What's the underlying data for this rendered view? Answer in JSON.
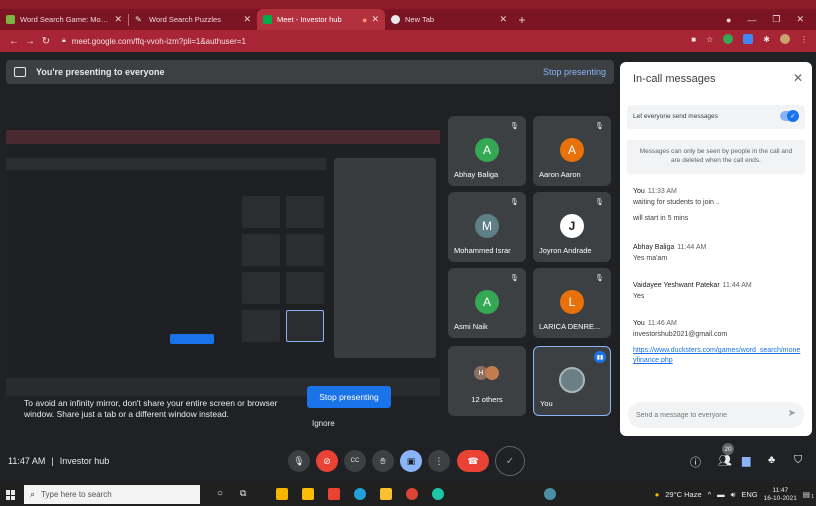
{
  "browser": {
    "tabs": [
      {
        "title": "Word Search Game: Money and",
        "favicon_color": "#7cb342"
      },
      {
        "title": "Word Search Puzzles",
        "favicon_color": "#e8eaed"
      },
      {
        "title": "Meet - Investor hub",
        "favicon_color": "#00ac47"
      },
      {
        "title": "New Tab",
        "favicon_color": "#e8eaed"
      }
    ],
    "url": "meet.google.com/ffq-vvoh-izm?pli=1&authuser=1"
  },
  "banner": {
    "text": "You're presenting to everyone",
    "stop_label": "Stop presenting"
  },
  "presenting": {
    "warning": "To avoid an infinity mirror, don't share your entire screen or browser window. Share just a tab or a different window instead.",
    "stop_button": "Stop presenting",
    "ignore_button": "Ignore"
  },
  "participants": [
    {
      "initial": "A",
      "name": "Abhay Baliga",
      "color": "#34a853"
    },
    {
      "initial": "A",
      "name": "Aaron Aaron",
      "color": "#e8710a"
    },
    {
      "initial": "M",
      "name": "Mohammed Israr",
      "color": "#5f7f86"
    },
    {
      "initial": "J",
      "name": "Joyron Andrade",
      "color": "#ffffff"
    },
    {
      "initial": "A",
      "name": "Asmi Naik",
      "color": "#34a853"
    },
    {
      "initial": "L",
      "name": "LARICA DENRE...",
      "color": "#e8710a"
    },
    {
      "name": "12 others"
    },
    {
      "name": "You"
    }
  ],
  "chat": {
    "title": "In-call messages",
    "toggle_label": "Let everyone send messages",
    "notice": "Messages can only be seen by people in the call and are deleted when the call ends.",
    "messages": [
      {
        "sender": "You",
        "time": "11:33 AM",
        "lines": [
          "waiting for students to join ..",
          "will start in 5 mins"
        ]
      },
      {
        "sender": "Abhay Baliga",
        "time": "11:44 AM",
        "lines": [
          "Yes ma'am"
        ]
      },
      {
        "sender": "Vaidayee Yeshwant Patekar",
        "time": "11:44 AM",
        "lines": [
          "Yes"
        ]
      },
      {
        "sender": "You",
        "time": "11:46 AM",
        "lines": [
          "investorshub2021@gmail.com"
        ],
        "link": "https://www.ducksters.com/games/word_search/moneyfinance.php"
      }
    ],
    "input_placeholder": "Send a message to everyone"
  },
  "meeting_bar": {
    "time": "11:47 AM",
    "name": "Investor hub",
    "people_count": "20"
  },
  "taskbar": {
    "search_placeholder": "Type here to search",
    "weather": "29°C Haze",
    "lang": "ENG",
    "clock_time": "11:47",
    "clock_date": "16-10-2021",
    "notif_count": "1"
  }
}
